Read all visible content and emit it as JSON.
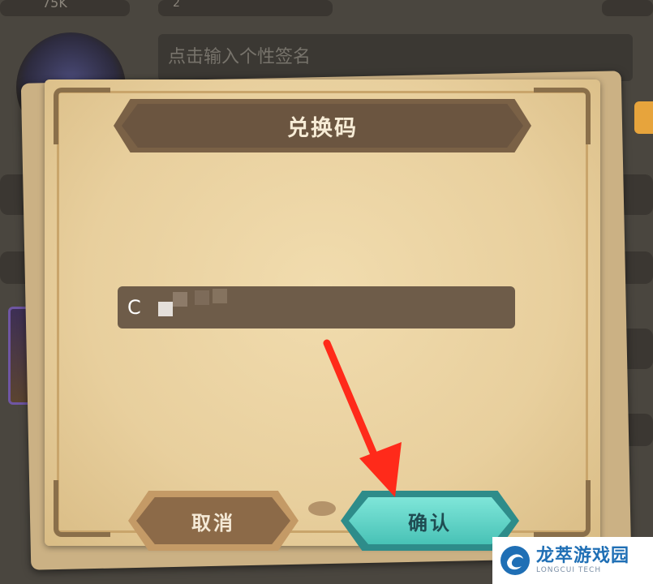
{
  "background": {
    "coin_value": "75K",
    "level_value": "2",
    "signature_placeholder": "点击输入个性签名"
  },
  "dialog": {
    "title": "兑换码",
    "code_input_value": "C",
    "cancel_label": "取消",
    "confirm_label": "确认"
  },
  "annotation": {
    "arrow_color": "#ff2a1a"
  },
  "watermark": {
    "name": "龙萃游戏园",
    "sub": "LONGCUI TECH"
  },
  "colors": {
    "parchment": "#ecd4a3",
    "title_banner": "#6b5540",
    "confirm_button": "#5fd3c6",
    "cancel_button": "#8c6a48",
    "watermark_blue": "#1f6fb5"
  }
}
